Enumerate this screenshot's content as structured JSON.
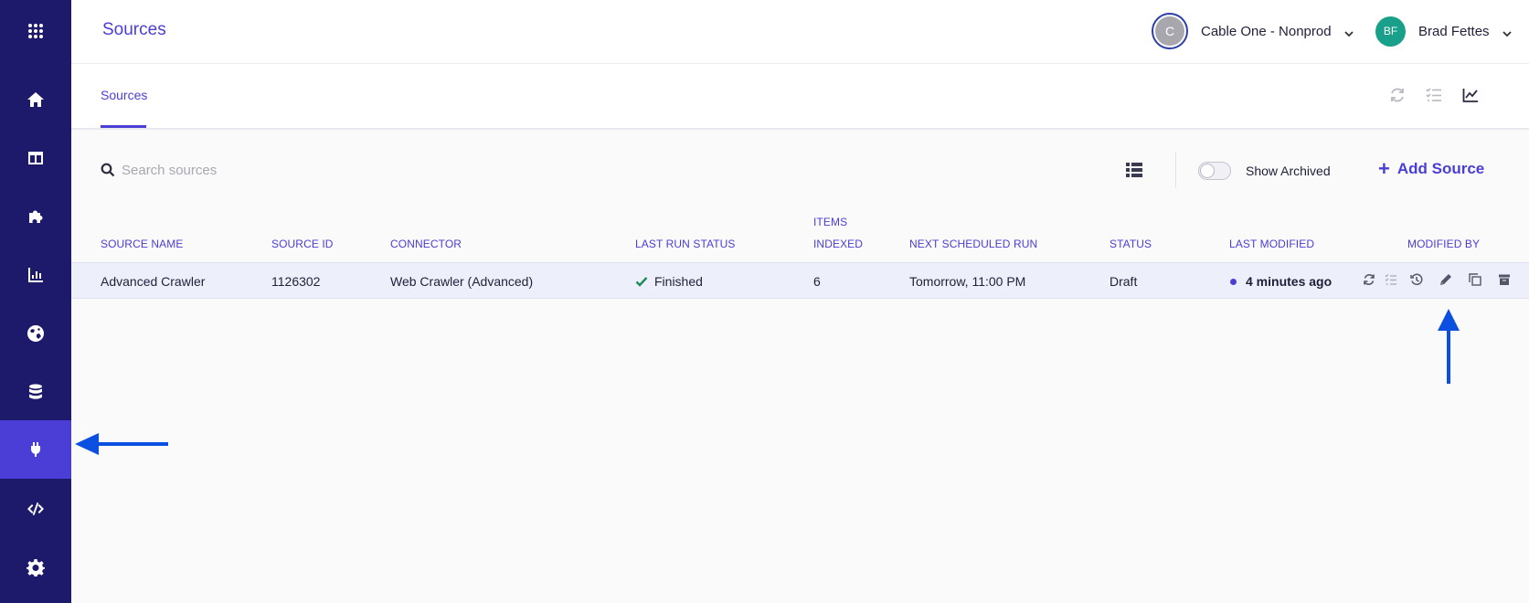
{
  "sidebar": {
    "items": [
      {
        "icon": "apps-grid-icon"
      },
      {
        "icon": "home-icon"
      },
      {
        "icon": "table-icon"
      },
      {
        "icon": "puzzle-icon"
      },
      {
        "icon": "bar-chart-icon"
      },
      {
        "icon": "globe-icon"
      },
      {
        "icon": "database-icon"
      },
      {
        "icon": "plug-icon",
        "active": true
      },
      {
        "icon": "code-icon"
      },
      {
        "icon": "gear-icon"
      }
    ]
  },
  "header": {
    "title": "Sources",
    "org": {
      "avatar_initial": "C",
      "name": "Cable One - Nonprod"
    },
    "user": {
      "initials": "BF",
      "name": "Brad Fettes"
    }
  },
  "tabs": [
    {
      "label": "Sources",
      "active": true
    }
  ],
  "toolbar": {
    "search_placeholder": "Search sources",
    "show_archived_label": "Show Archived",
    "show_archived": false,
    "add_source_label": "Add Source"
  },
  "table": {
    "columns": {
      "source_name": "SOURCE NAME",
      "source_id": "SOURCE ID",
      "connector": "CONNECTOR",
      "last_run_status": "LAST RUN STATUS",
      "items_indexed_line1": "ITEMS",
      "items_indexed_line2": "INDEXED",
      "next_scheduled_run": "NEXT SCHEDULED RUN",
      "status": "STATUS",
      "last_modified": "LAST MODIFIED",
      "modified_by": "MODIFIED BY"
    },
    "rows": [
      {
        "source_name": "Advanced Crawler",
        "source_id": "1126302",
        "connector": "Web Crawler (Advanced)",
        "last_run_status": "Finished",
        "items_indexed": "6",
        "next_scheduled_run": "Tomorrow, 11:00 PM",
        "status": "Draft",
        "last_modified": "4 minutes ago"
      }
    ]
  },
  "colors": {
    "sidebar_bg": "#1d1a6b",
    "sidebar_active": "#4a3ed6",
    "accent": "#4a3ed6",
    "success": "#1f8a5a",
    "annotation_arrow": "#0a4fe0"
  }
}
